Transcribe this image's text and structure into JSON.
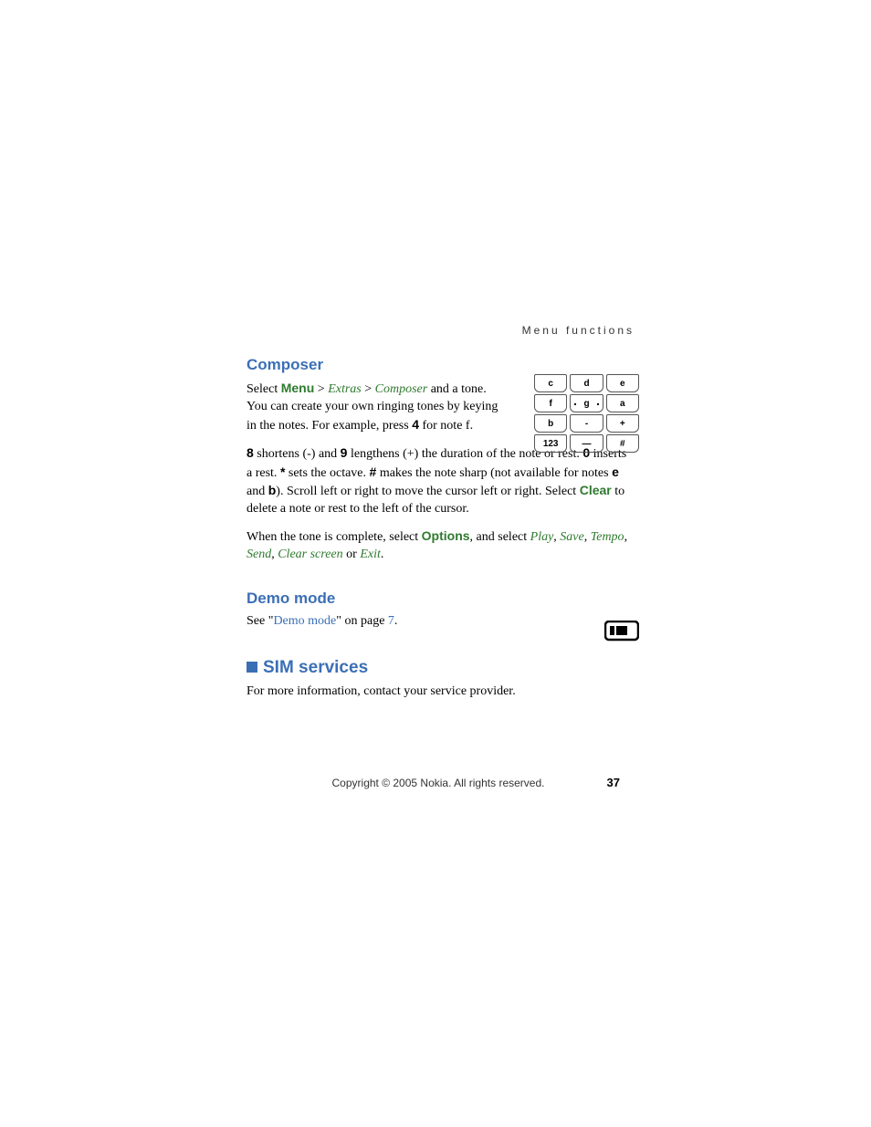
{
  "header": {
    "running": "Menu functions"
  },
  "composer": {
    "heading": "Composer",
    "p1_pre": "Select ",
    "menu": "Menu",
    "gt": " > ",
    "extras": "Extras",
    "composer": "Composer",
    "p1_post": " and a tone. You can create your own ringing tones by keying in the notes. For example, press ",
    "key4": "4",
    "p1_end": " for note f.",
    "p2a": "8",
    "p2b": " shortens (-) and ",
    "p2c": "9",
    "p2d": " lengthens (+) the duration of the note or rest. ",
    "p2e": "0",
    "p2f": " inserts a rest. ",
    "p2g": "*",
    "p2h": " sets the octave. ",
    "p2i": "#",
    "p2j": " makes the note sharp (not available for notes ",
    "p2k": "e",
    "p2l": " and ",
    "p2m": "b",
    "p2n": "). Scroll left or right to move the cursor left or right. Select ",
    "clear": "Clear",
    "p2o": " to delete a note or rest to the left of the cursor.",
    "p3a": "When the tone is complete, select ",
    "options": "Options",
    "p3b": ", and select ",
    "play": "Play",
    "save": "Save",
    "tempo": "Tempo",
    "send": "Send",
    "clearscreen": "Clear screen",
    "or": " or ",
    "exit": "Exit",
    "comma": ", ",
    "period": "."
  },
  "keypad": {
    "r1": [
      "c",
      "d",
      "e"
    ],
    "r2": [
      "f",
      "g",
      "a"
    ],
    "r3": [
      "b",
      "-",
      "+"
    ],
    "r4": [
      "123",
      "—",
      "#"
    ]
  },
  "demo": {
    "heading": "Demo mode",
    "see_pre": "See \"",
    "link": "Demo mode",
    "see_mid": "\" on page ",
    "page": "7",
    "see_end": "."
  },
  "sim": {
    "heading": "SIM services",
    "body": "For more information, contact your service provider."
  },
  "footer": {
    "copyright": "Copyright © 2005 Nokia. All rights reserved.",
    "page": "37"
  }
}
